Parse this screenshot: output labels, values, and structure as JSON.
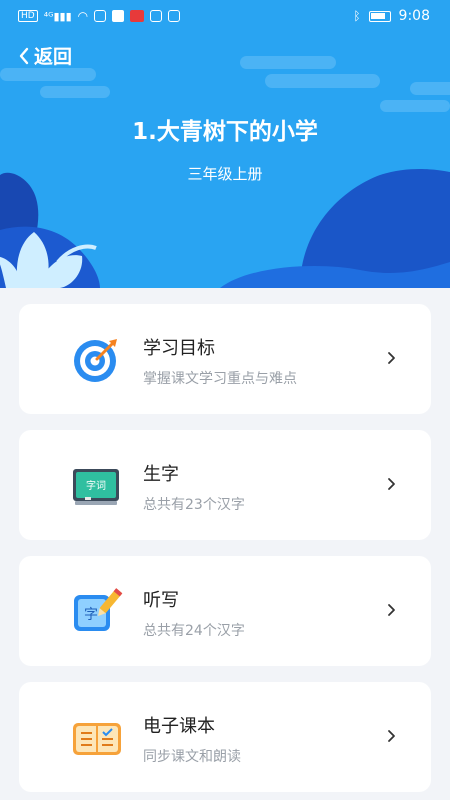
{
  "status_bar": {
    "left_icons": [
      "HD",
      "4G"
    ],
    "time": "9:08"
  },
  "header": {
    "back_label": "返回",
    "title": "1.大青树下的小学",
    "subtitle": "三年级上册"
  },
  "cards": [
    {
      "title": "学习目标",
      "desc": "掌握课文学习重点与难点",
      "icon": "target-icon"
    },
    {
      "title": "生字",
      "desc": "总共有23个汉字",
      "icon": "blackboard-icon",
      "icon_text": "字词"
    },
    {
      "title": "听写",
      "desc": "总共有24个汉字",
      "icon": "dictation-icon",
      "icon_text": "字"
    },
    {
      "title": "电子课本",
      "desc": "同步课文和朗读",
      "icon": "book-icon"
    }
  ],
  "colors": {
    "header_bg": "#29a4f2",
    "accent": "#1f7fe0",
    "page_bg": "#f2f4f8"
  }
}
